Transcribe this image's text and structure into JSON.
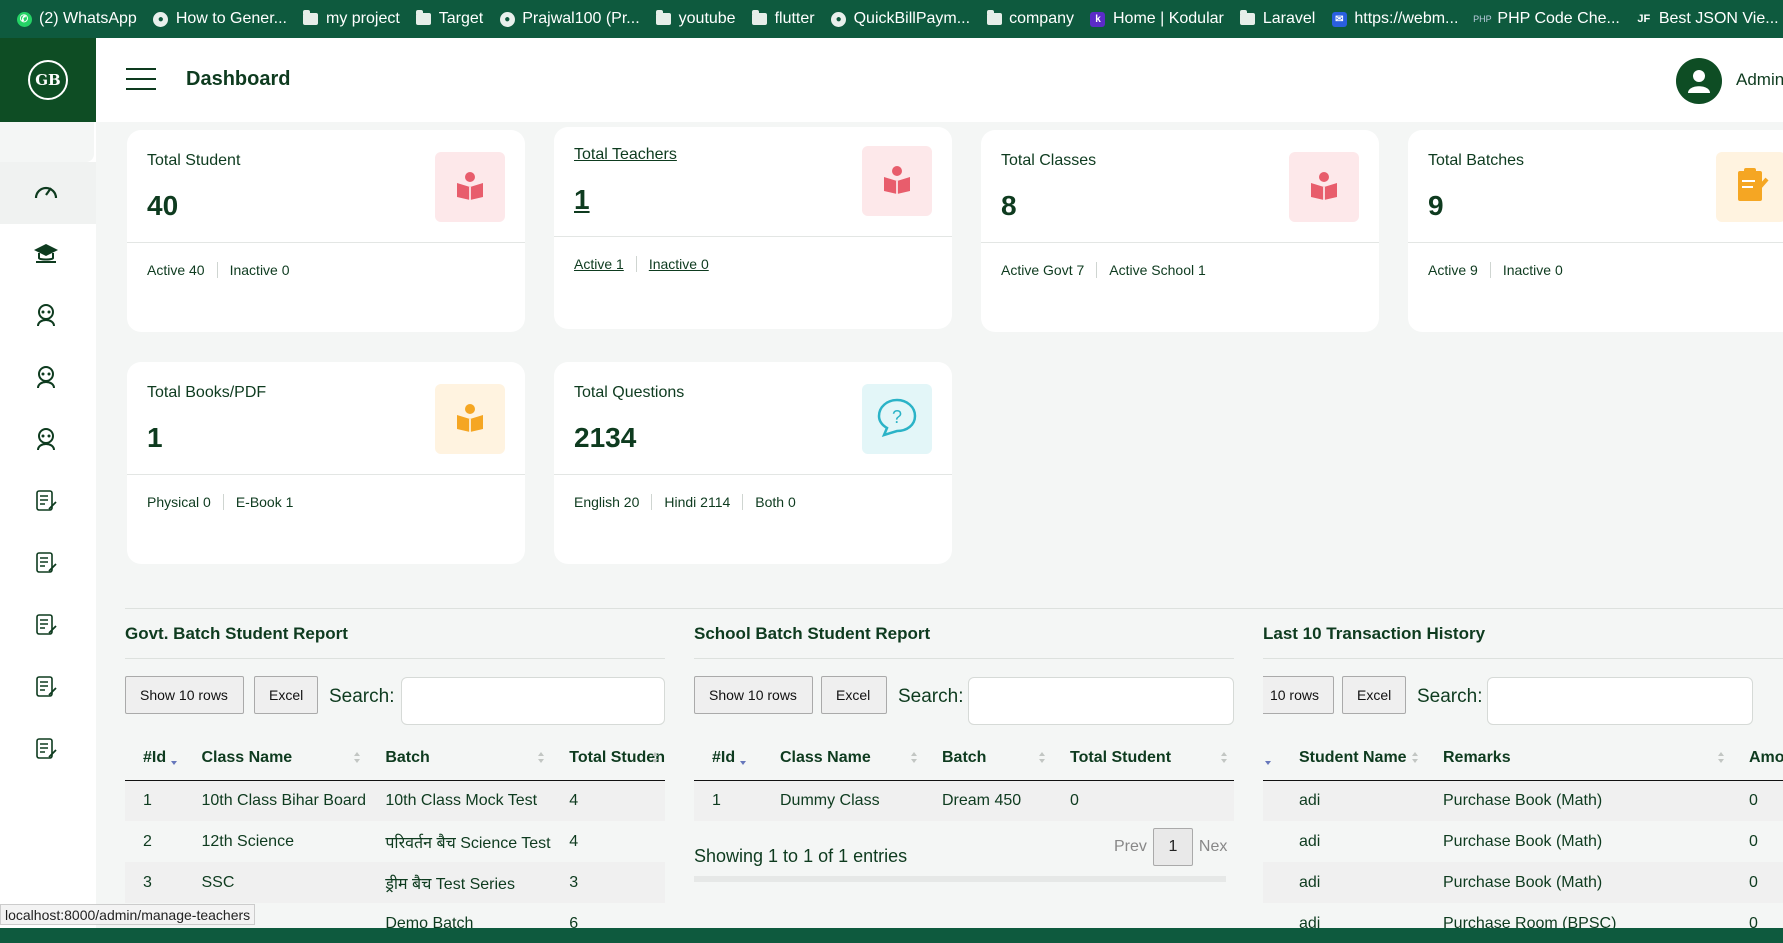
{
  "bookmarks": [
    {
      "label": "(2) WhatsApp",
      "icon": "whatsapp-icon"
    },
    {
      "label": "How to Gener...",
      "icon": "bookmark-icon"
    },
    {
      "label": "my project",
      "icon": "folder-icon"
    },
    {
      "label": "Target",
      "icon": "folder-icon"
    },
    {
      "label": "Prajwal100 (Pr...",
      "icon": "github-icon"
    },
    {
      "label": "youtube",
      "icon": "folder-icon"
    },
    {
      "label": "flutter",
      "icon": "folder-icon"
    },
    {
      "label": "QuickBillPaym...",
      "icon": "globe-icon"
    },
    {
      "label": "company",
      "icon": "folder-icon"
    },
    {
      "label": "Home | Kodular",
      "icon": "kodular-icon"
    },
    {
      "label": "Laravel",
      "icon": "folder-icon"
    },
    {
      "label": "https://webm...",
      "icon": "webmail-icon"
    },
    {
      "label": "PHP Code Che...",
      "icon": "php-icon"
    },
    {
      "label": "Best JSON Vie...",
      "icon": "json-icon"
    }
  ],
  "header": {
    "title": "Dashboard",
    "user": "Admin",
    "logo_text": "GB"
  },
  "sidebar": {
    "items": [
      "speedometer-icon",
      "graduation-cap-icon",
      "teacher-icon",
      "teacher-icon",
      "teacher-icon",
      "report-icon",
      "report-icon",
      "report-icon",
      "report-icon",
      "report-icon"
    ]
  },
  "cards": [
    {
      "title": "Total Student",
      "value": "40",
      "subs": [
        "Active 40",
        "Inactive 0"
      ],
      "icon": "reader-icon",
      "accent": "#e85d6c",
      "bg": "#fde8ea",
      "link": false
    },
    {
      "title": "Total Teachers",
      "value": "1",
      "subs": [
        "Active 1",
        "Inactive 0"
      ],
      "icon": "reader-icon",
      "accent": "#e85d6c",
      "bg": "#fde8ea",
      "link": true
    },
    {
      "title": "Total Classes",
      "value": "8",
      "subs": [
        "Active Govt 7",
        "Active School 1"
      ],
      "icon": "reader-icon",
      "accent": "#e85d6c",
      "bg": "#fde8ea",
      "link": false
    },
    {
      "title": "Total Batches",
      "value": "9",
      "subs": [
        "Active 9",
        "Inactive 0"
      ],
      "icon": "clipboard-icon",
      "accent": "#f5a623",
      "bg": "#fff3e0",
      "link": false
    },
    {
      "title": "Total Books/PDF",
      "value": "1",
      "subs": [
        "Physical 0",
        "E-Book 1"
      ],
      "icon": "reader-icon",
      "accent": "#f5a623",
      "bg": "#fff3e0",
      "link": false
    },
    {
      "title": "Total Questions",
      "value": "2134",
      "subs": [
        "English 20",
        "Hindi 2114",
        "Both 0"
      ],
      "icon": "question-icon",
      "accent": "#2bb3c7",
      "bg": "#e3f6f8",
      "link": false
    }
  ],
  "reports": {
    "govt": {
      "title": "Govt. Batch Student Report",
      "show_rows": "Show 10 rows",
      "excel": "Excel",
      "search_label": "Search:",
      "headers": [
        "#Id",
        "Class Name",
        "Batch",
        "Total Studen"
      ],
      "rows": [
        [
          "1",
          "10th Class Bihar Board",
          "10th Class Mock Test",
          "4"
        ],
        [
          "2",
          "12th Science",
          "परिवर्तन बैच Science Test",
          "4"
        ],
        [
          "3",
          "SSC",
          "ड्रीम बैच Test Series",
          "3"
        ],
        [
          "",
          "",
          "Demo Batch",
          "6"
        ]
      ]
    },
    "school": {
      "title": "School Batch Student Report",
      "show_rows": "Show 10 rows",
      "excel": "Excel",
      "search_label": "Search:",
      "headers": [
        "#Id",
        "Class Name",
        "Batch",
        "Total Student"
      ],
      "rows": [
        [
          "1",
          "Dummy Class",
          "Dream 450",
          "0"
        ]
      ],
      "info": "Showing 1 to 1 of 1 entries",
      "prev": "Prev",
      "page": "1",
      "next": "Nex"
    },
    "transactions": {
      "title": "Last 10 Transaction History",
      "show_rows": "10 rows",
      "excel": "Excel",
      "search_label": "Search:",
      "headers": [
        "",
        "Student Name",
        "Remarks",
        "Amou"
      ],
      "rows": [
        [
          "",
          "adi",
          "Purchase Book (Math)",
          "0"
        ],
        [
          "",
          "adi",
          "Purchase Book (Math)",
          "0"
        ],
        [
          "",
          "adi",
          "Purchase Book (Math)",
          "0"
        ],
        [
          "",
          "adi",
          "Purchase Room (BPSC)",
          "0"
        ]
      ]
    }
  },
  "status_url": "localhost:8000/admin/manage-teachers"
}
